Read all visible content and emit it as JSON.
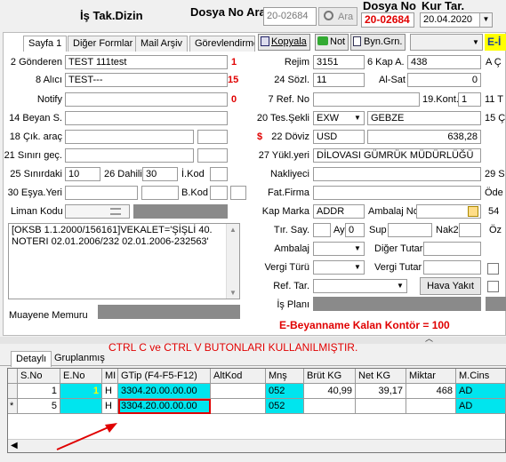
{
  "header": {
    "title": "İş Tak.Dizin",
    "dosya_no_ara_label": "Dosya No Ara",
    "dosya_no_ara_value": "20-02684",
    "ara_button": "Ara",
    "dosya_no_label": "Dosya No",
    "dosya_no_value": "20-02684",
    "kur_tar_label": "Kur Tar.",
    "kur_tar_value": "20.04.2020"
  },
  "tabs": [
    "Sayfa 1",
    "Diğer Formlar",
    "Mail Arşiv",
    "Görevlendirme"
  ],
  "toolbar": {
    "kopyala": "Kopyala",
    "not": "Not",
    "byn_grn": "Byn.Grn.",
    "e_label": "E-İ"
  },
  "left": {
    "gonderen_label": "2 Gönderen",
    "gonderen_value": "TEST 111test",
    "gonderen_count": "1",
    "alici_label": "8 Alıcı",
    "alici_value": "TEST---",
    "alici_count": "15",
    "notify_label": "Notify",
    "notify_count": "0",
    "beyan_label": "14 Beyan S.",
    "cik_arac_label": "18 Çık. araç",
    "sinir_gec_label": "21 Sınırı geç.",
    "sinirdaki_label": "25 Sınırdaki",
    "sinirdaki_value": "10",
    "dahili_label": "26 Dahili",
    "dahili_value": "30",
    "ikod_label": "İ.Kod",
    "esya_yeri_label": "30 Eşya.Yeri",
    "bkod_label": "B.Kod",
    "liman_label": "Liman Kodu",
    "note_text": "[OKSB 1.1.2000/156161]VEKALET='ŞİŞLİ 40. NOTERI 02.01.2006/232 02.01.2006-232563'",
    "muayene_label": "Muayene Memuru"
  },
  "right": {
    "rejim_label": "Rejim",
    "rejim_value": "3151",
    "kap_a_label": "6 Kap A.",
    "kap_a_value": "438",
    "a_label": "A Ç",
    "sozl_label": "24 Sözl.",
    "sozl_value": "11",
    "al_sat_label": "Al-Sat",
    "al_sat_value": "0",
    "ref_no_label": "7 Ref. No",
    "kont_label": "19.Kont.",
    "kont_value": "1",
    "tes_sekli_label": "20 Tes.Şekli",
    "tes_sekli_value": "EXW",
    "tes_place_value": "GEBZE",
    "doviz_label": "22 Döviz",
    "doviz_value": "USD",
    "doviz_amount": "638,28",
    "yukl_label": "27 Yükl.yeri",
    "yukl_value": "DİLOVASI GÜMRÜK MÜDÜRLÜĞÜ",
    "nakliyeci_label": "Nakliyeci",
    "fat_firma_label": "Fat.Firma",
    "kap_marka_label": "Kap Marka",
    "kap_marka_value": "ADDR",
    "ambalaj_no_label": "Ambalaj No",
    "tir_say_label": "Tır. Say.",
    "ay_label": "Ay",
    "ay_value": "0",
    "sup_label": "Sup",
    "nak2_label": "Nak2",
    "ambalaj_label": "Ambalaj",
    "diger_tutar_label": "Diğer Tutar",
    "vergi_turu_label": "Vergi Türü",
    "vergi_tutar_label": "Vergi Tutar",
    "ref_tar_label": "Ref. Tar.",
    "hava_yakit_button": "Hava Yakıt",
    "is_plani_label": "İş Planı",
    "edge_11": "11 T",
    "edge_15": "15 Ç",
    "edge_29": "29 S",
    "edge_ode": "Öde",
    "edge_54": "54",
    "edge_oz": "Öz",
    "kontor_text": "E-Beyanname Kalan Kontör = 100"
  },
  "annotation": "CTRL C ve CTRL V BUTONLARI KULLANILMIŞTIR.",
  "detail_tabs": [
    "Detaylı",
    "Gruplanmış"
  ],
  "grid": {
    "columns": [
      "S.No",
      "E.No",
      "MI",
      "GTip (F4-F5-F12)",
      "AltKod",
      "Mnş",
      "Brüt KG",
      "Net KG",
      "Miktar",
      "M.Cins"
    ],
    "rows": [
      {
        "marker": "",
        "sno": "1",
        "eno": "1",
        "mi": "H",
        "gtip": "3304.20.00.00.00",
        "altkod": "",
        "mns": "052",
        "brut": "40,99",
        "net": "39,17",
        "miktar": "468",
        "mcins": "AD"
      },
      {
        "marker": "*",
        "sno": "5",
        "eno": "",
        "mi": "H",
        "gtip": "3304.20.00.00.00",
        "altkod": "",
        "mns": "052",
        "brut": "",
        "net": "",
        "miktar": "",
        "mcins": "AD"
      }
    ]
  },
  "colors": {
    "accent_red": "#e00000",
    "cyan": "#00e5ee",
    "yellow": "#ffff00"
  }
}
